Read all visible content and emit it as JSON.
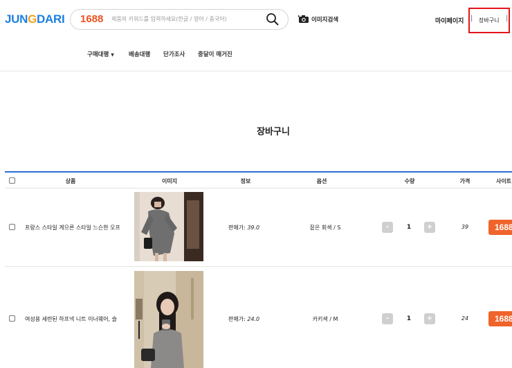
{
  "header": {
    "logo_a": "JUN",
    "logo_b": "G",
    "logo_c": "DARI",
    "search_brand": "1688",
    "search_placeholder": "제품의 키워드를 입력하세요(한글 / 영어 / 중국어)",
    "image_search_label": "이미지검색",
    "mypage_label": "마이페이지",
    "cart_label": "장바구니"
  },
  "nav": {
    "purchase": "구매대행",
    "shipping": "배송대행",
    "price_check": "단가조사",
    "magazine": "중달이 매거진"
  },
  "page_title": "장바구니",
  "columns": {
    "product": "상품",
    "image": "이미지",
    "info": "정보",
    "option": "옵션",
    "quantity": "수량",
    "price": "가격",
    "site": "사이트"
  },
  "rows": [
    {
      "name": "프랑스 스타일 게으른 스타일 느슨한 오프",
      "sale_label": "판매가: ",
      "sale_value": "39.0",
      "option": "짙은 회색 / S",
      "qty": "1",
      "price": "39",
      "site": "1688"
    },
    {
      "name": "여성용 세련된 하프넥 니트 이너웨어, 슬",
      "sale_label": "판매가: ",
      "sale_value": "24.0",
      "option": "카키색 / M",
      "qty": "1",
      "price": "24",
      "site": "1688"
    }
  ],
  "qty_minus": "-",
  "qty_plus": "+",
  "colors": {
    "accent_blue": "#2b6fd4",
    "site_orange": "#f0642b",
    "highlight_red": "#e2141a"
  }
}
